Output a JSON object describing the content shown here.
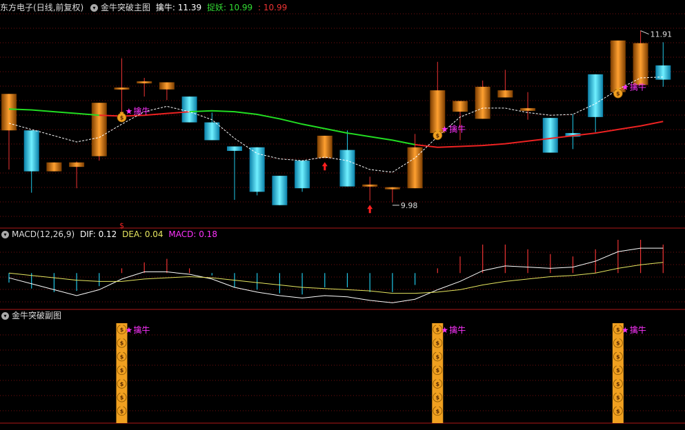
{
  "header_main": {
    "stock": "东方电子",
    "mode": "(日线,前复权)",
    "indicator": "金牛突破主图",
    "k1_label": "擒牛:",
    "k1_value": "11.39",
    "k2_label": "捉妖:",
    "k2_value": "10.99",
    "k3_label": ":",
    "k3_value": "10.99"
  },
  "header_macd": {
    "name": "MACD(12,26,9)",
    "dif_label": "DIF:",
    "dif_value": "0.12",
    "dea_label": "DEA:",
    "dea_value": "0.04",
    "macd_label": "MACD:",
    "macd_value": "0.18"
  },
  "header_sub": {
    "name": "金牛突破副图"
  },
  "annotations": {
    "high_label": "11.91",
    "low_label": "9.98",
    "signal_text": "擒牛",
    "dollar_mark": "$"
  },
  "colors": {
    "up": "#e07a10",
    "down": "#20c8e8",
    "ma_green": "#22dd22",
    "ma_red": "#ee2222",
    "grid": "#7a1010",
    "dif": "#ffffff",
    "dea": "#e8e860",
    "signal": "#ff33ff",
    "bag": "#f0a020"
  },
  "chart_data": [
    {
      "type": "candlestick",
      "ylim": [
        9.7,
        12.1
      ],
      "candles": [
        {
          "o": 10.79,
          "h": 11.2,
          "l": 10.35,
          "c": 11.2
        },
        {
          "o": 10.79,
          "h": 10.79,
          "l": 10.09,
          "c": 10.33
        },
        {
          "o": 10.33,
          "h": 10.43,
          "l": 10.33,
          "c": 10.43
        },
        {
          "o": 10.38,
          "h": 10.44,
          "l": 10.14,
          "c": 10.43
        },
        {
          "o": 10.5,
          "h": 11.1,
          "l": 10.45,
          "c": 11.1
        },
        {
          "o": 11.26,
          "h": 11.6,
          "l": 10.95,
          "c": 11.26
        },
        {
          "o": 11.33,
          "h": 11.38,
          "l": 11.17,
          "c": 11.33
        },
        {
          "o": 11.25,
          "h": 11.33,
          "l": 11.13,
          "c": 11.33
        },
        {
          "o": 11.17,
          "h": 11.17,
          "l": 10.88,
          "c": 10.88
        },
        {
          "o": 10.88,
          "h": 10.99,
          "l": 10.7,
          "c": 10.68
        },
        {
          "o": 10.61,
          "h": 10.61,
          "l": 10.01,
          "c": 10.56
        },
        {
          "o": 10.6,
          "h": 10.6,
          "l": 10.06,
          "c": 10.1
        },
        {
          "o": 10.28,
          "h": 10.28,
          "l": 9.95,
          "c": 9.95
        },
        {
          "o": 10.45,
          "h": 10.45,
          "l": 10.1,
          "c": 10.14
        },
        {
          "o": 10.48,
          "h": 10.73,
          "l": 10.48,
          "c": 10.73
        },
        {
          "o": 10.57,
          "h": 10.79,
          "l": 10.16,
          "c": 10.16
        },
        {
          "o": 10.17,
          "h": 10.27,
          "l": 10.0,
          "c": 10.17
        },
        {
          "o": 10.14,
          "h": 10.14,
          "l": 9.98,
          "c": 10.14
        },
        {
          "o": 10.14,
          "h": 10.75,
          "l": 10.14,
          "c": 10.6
        },
        {
          "o": 10.76,
          "h": 11.56,
          "l": 10.75,
          "c": 11.24
        },
        {
          "o": 11.0,
          "h": 11.12,
          "l": 10.68,
          "c": 11.12
        },
        {
          "o": 10.92,
          "h": 11.35,
          "l": 10.92,
          "c": 11.28
        },
        {
          "o": 11.16,
          "h": 11.47,
          "l": 11.16,
          "c": 11.24
        },
        {
          "o": 11.01,
          "h": 11.22,
          "l": 10.91,
          "c": 11.04
        },
        {
          "o": 10.93,
          "h": 10.93,
          "l": 10.54,
          "c": 10.54
        },
        {
          "o": 10.76,
          "h": 10.97,
          "l": 10.58,
          "c": 10.72
        },
        {
          "o": 11.42,
          "h": 11.42,
          "l": 10.77,
          "c": 10.94
        },
        {
          "o": 11.22,
          "h": 11.6,
          "l": 11.22,
          "c": 11.8
        },
        {
          "o": 11.3,
          "h": 11.91,
          "l": 11.3,
          "c": 11.77
        },
        {
          "o": 11.52,
          "h": 11.78,
          "l": 11.28,
          "c": 11.36
        }
      ],
      "ma_slow": [
        11.03,
        11.02,
        11.0,
        10.98,
        10.96,
        10.95,
        10.96,
        10.98,
        11.0,
        11.01,
        11.0,
        10.97,
        10.92,
        10.86,
        10.81,
        10.76,
        10.72,
        10.68,
        10.63,
        10.6,
        10.61,
        10.62,
        10.64,
        10.67,
        10.7,
        10.73,
        10.76,
        10.8,
        10.84,
        10.89
      ],
      "ma_slow_color_switch": [
        4,
        19
      ],
      "ma_fast": [
        10.87,
        10.8,
        10.73,
        10.66,
        10.71,
        10.86,
        11.0,
        11.06,
        11.0,
        10.91,
        10.7,
        10.53,
        10.47,
        10.45,
        10.49,
        10.45,
        10.35,
        10.32,
        10.48,
        10.72,
        10.94,
        11.04,
        11.04,
        10.99,
        10.96,
        10.97,
        11.09,
        11.25,
        11.38,
        11.39
      ],
      "signals": [
        {
          "index": 5,
          "price": 10.95
        },
        {
          "index": 19,
          "price": 10.75
        },
        {
          "index": 27,
          "price": 11.22
        }
      ],
      "up_arrows": [
        {
          "index": 14
        },
        {
          "index": 16
        }
      ]
    },
    {
      "type": "line",
      "ylim": [
        -0.3,
        0.28
      ],
      "dif": [
        -0.04,
        -0.09,
        -0.14,
        -0.19,
        -0.14,
        -0.05,
        0.01,
        0.01,
        -0.01,
        -0.05,
        -0.12,
        -0.16,
        -0.19,
        -0.21,
        -0.19,
        -0.2,
        -0.23,
        -0.25,
        -0.22,
        -0.14,
        -0.07,
        0.02,
        0.06,
        0.05,
        0.04,
        0.05,
        0.1,
        0.18,
        0.21,
        0.21
      ],
      "dea": [
        0.0,
        -0.02,
        -0.04,
        -0.06,
        -0.07,
        -0.07,
        -0.05,
        -0.04,
        -0.03,
        -0.04,
        -0.06,
        -0.08,
        -0.1,
        -0.12,
        -0.13,
        -0.14,
        -0.15,
        -0.17,
        -0.17,
        -0.16,
        -0.14,
        -0.1,
        -0.07,
        -0.05,
        -0.03,
        -0.02,
        0.0,
        0.04,
        0.07,
        0.09
      ],
      "macd": [
        -0.08,
        -0.13,
        -0.16,
        -0.15,
        -0.11,
        0.04,
        0.09,
        0.12,
        0.04,
        -0.02,
        -0.12,
        -0.14,
        -0.17,
        -0.18,
        -0.12,
        -0.12,
        -0.16,
        -0.16,
        -0.1,
        0.04,
        0.14,
        0.24,
        0.24,
        0.2,
        0.16,
        0.14,
        0.2,
        0.28,
        0.28,
        0.24
      ]
    },
    {
      "type": "bar",
      "signal_indices": [
        5,
        19,
        27
      ],
      "stack_count": 7
    }
  ]
}
